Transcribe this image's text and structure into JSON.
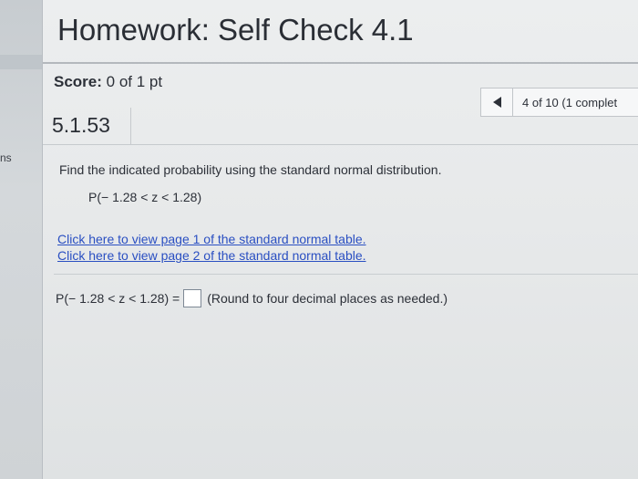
{
  "sidebar": {
    "fragment_text": "ns"
  },
  "header": {
    "title": "Homework: Self Check 4.1"
  },
  "score": {
    "label": "Score:",
    "value": "0 of 1 pt"
  },
  "navigation": {
    "position_text": "4 of 10 (1 complet"
  },
  "question": {
    "number": "5.1.53",
    "instruction": "Find the indicated probability using the standard normal distribution.",
    "expression": "P(− 1.28 < z < 1.28)",
    "links": [
      "Click here to view page 1 of the standard normal table.",
      "Click here to view page 2 of the standard normal table."
    ],
    "answer_prefix": "P(− 1.28 < z < 1.28) =",
    "answer_value": "",
    "answer_hint": "(Round to four decimal places as needed.)"
  }
}
